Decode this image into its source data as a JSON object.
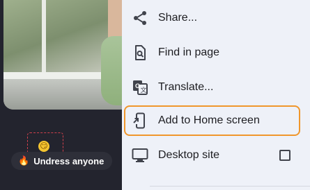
{
  "background": {
    "tag_label": "Undress anyone",
    "tag_emoji": "🔥",
    "chip_emoji": "😏"
  },
  "menu": {
    "items": [
      {
        "label": "Share...",
        "icon": "share-icon"
      },
      {
        "label": "Find in page",
        "icon": "find-in-page-icon"
      },
      {
        "label": "Translate...",
        "icon": "translate-icon"
      },
      {
        "label": "Add to Home screen",
        "icon": "add-to-home-screen-icon",
        "highlighted": true
      },
      {
        "label": "Desktop site",
        "icon": "desktop-icon",
        "checkbox": false
      }
    ]
  },
  "colors": {
    "menu_bg": "#eef1f8",
    "highlight_border": "#f0962b",
    "page_bg": "#1f2029"
  }
}
